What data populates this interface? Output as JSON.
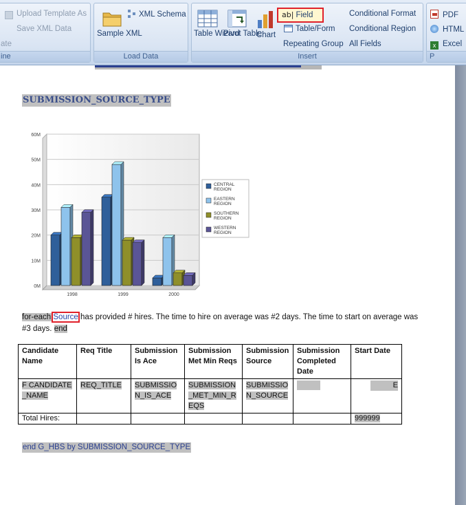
{
  "ribbon": {
    "template_group": {
      "upload_template": "Upload Template As",
      "save_xml": "Save XML Data",
      "cut_left": "ate",
      "cut_label": "ine"
    },
    "load_data": {
      "sample_xml": "Sample XML",
      "xml_schema": "XML Schema",
      "label": "Load Data"
    },
    "insert": {
      "table_wizard": "Table Wizard",
      "pivot_table": "Pivot Table",
      "chart": "Chart",
      "field": "Field",
      "table_form": "Table/Form",
      "repeating_group": "Repeating Group",
      "conditional_format": "Conditional Format",
      "conditional_region": "Conditional Region",
      "all_fields": "All Fields",
      "label": "Insert"
    },
    "preview": {
      "pdf": "PDF",
      "html": "HTML",
      "excel": "Excel",
      "cut_label": "P"
    }
  },
  "document": {
    "heading": "SUBMISSION_SOURCE_TYPE",
    "para": {
      "pre": "for-each ",
      "source": "Source",
      "mid": " has provided # hires.  The time to hire on average was #2  days.  The time to start on average was #3 days.",
      "end": "end"
    },
    "table": {
      "headers": [
        "Candidate Name",
        "Req Title",
        "Submission Is Ace",
        "Submission Met Min Reqs",
        "Submission Source",
        "Submission Completed Date",
        "Start Date"
      ],
      "data_row": [
        "F CANDIDATE_NAME",
        "REQ_TITLE",
        "SUBMISSION_IS_ACE",
        "SUBMISSION_MET_MIN_REQS",
        "SUBMISSION_SOURCE",
        "",
        "E"
      ],
      "total_label": "Total Hires:",
      "total_value": "999999"
    },
    "end_line": "end G_HBS by SUBMISSION_SOURCE_TYPE"
  },
  "chart_data": {
    "type": "bar",
    "categories": [
      "1998",
      "1999",
      "2000"
    ],
    "series": [
      {
        "name": "CENTRAL REGION",
        "values": [
          20,
          35,
          3
        ],
        "color": "#2f5f9a"
      },
      {
        "name": "EASTERN REGION",
        "values": [
          31,
          48,
          19
        ],
        "color": "#8ec3ec"
      },
      {
        "name": "SOUTHERN REGION",
        "values": [
          19,
          18,
          5
        ],
        "color": "#8f8f2a"
      },
      {
        "name": "WESTERN REGION",
        "values": [
          29,
          17,
          4
        ],
        "color": "#5a5596"
      }
    ],
    "ytick_labels": [
      "0M",
      "10M",
      "20M",
      "30M",
      "40M",
      "50M",
      "60M"
    ],
    "ylim": [
      0,
      60
    ],
    "legend": "right"
  }
}
